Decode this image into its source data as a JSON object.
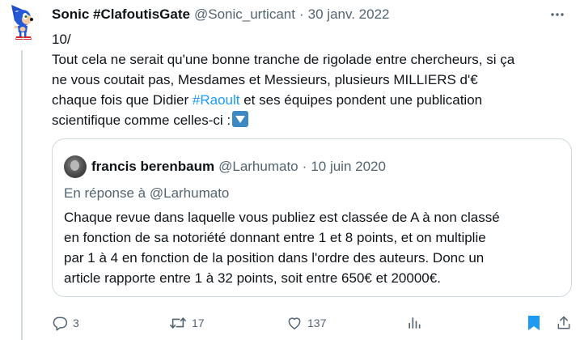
{
  "tweet": {
    "display_name": "Sonic #ClafoutisGate",
    "handle": "@Sonic_urticant",
    "separator": "·",
    "date": "30 janv. 2022",
    "text": {
      "line1": "10/",
      "line2": "Tout cela ne serait qu'une bonne tranche de rigolade entre chercheurs, si ça",
      "line3": "ne vous coutait pas, Mesdames et Messieurs, plusieurs MILLIERS d'€",
      "line4_before": "chaque fois que Didier ",
      "hashtag": "#Raoult",
      "line4_after": " et ses équipes pondent une publication",
      "line5": "scientifique comme celles-ci :"
    },
    "emoji_icon": "down-arrow-button-emoji"
  },
  "quote": {
    "display_name": "francis berenbaum",
    "handle": "@Larhumato",
    "separator": "·",
    "date": "10 juin 2020",
    "reply_to": "En réponse à @Larhumato",
    "text": {
      "line1": "Chaque revue dans laquelle vous publiez est classée de A à non classé",
      "line2": "en fonction de sa notoriété donnant entre 1 et 8 points, et on multiplie",
      "line3": "par 1 à 4 en fonction de la position dans l'ordre des auteurs. Donc un",
      "line4": "article rapporte entre 1 à 32 points, soit entre 650€ et 20000€."
    }
  },
  "actions": {
    "reply_count": "3",
    "retweet_count": "17",
    "like_count": "137",
    "colors": {
      "muted": "#536471",
      "bookmark_active": "#1d9bf0",
      "link": "#1d9bf0"
    }
  }
}
